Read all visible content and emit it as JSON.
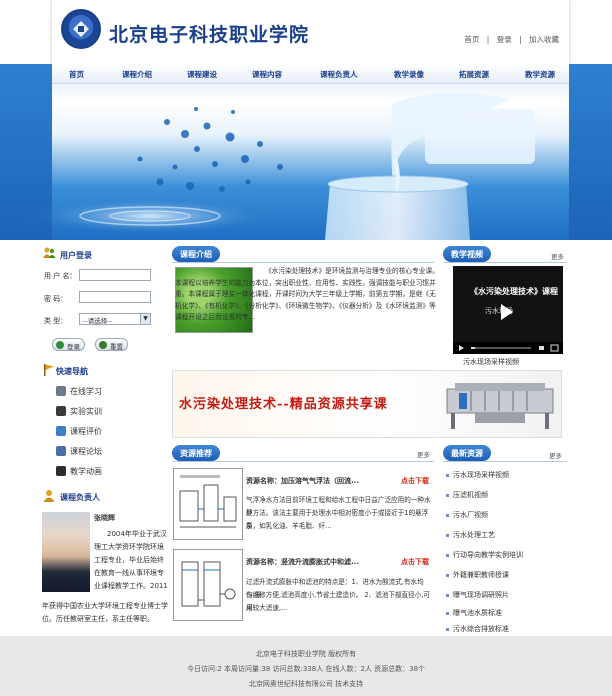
{
  "header": {
    "title": "北京电子科技职业学院",
    "toplinks": [
      "首页",
      "登录",
      "加入收藏"
    ]
  },
  "nav": [
    "首页",
    "课程介绍",
    "课程建设",
    "课程内容",
    "课程负责人",
    "教学录像",
    "拓展资源",
    "教学资源"
  ],
  "login": {
    "heading": "用户登录",
    "username_label": "用 户 名：",
    "password_label": "密    码：",
    "type_label": "类    型：",
    "type_selected": "--请选择--",
    "login_button": "登录",
    "reset_button": "重置"
  },
  "quick_nav": {
    "heading": "快速导航",
    "items": [
      "在线学习",
      "实验实训",
      "课程评价",
      "课程论坛",
      "教学动画"
    ]
  },
  "owner": {
    "heading": "课程负责人",
    "name": "张晓辉",
    "bio_lines": [
      "2004年毕业于武汉",
      "理工大学资环学院环境",
      "工程专业，毕业后始终",
      "在教育一线从事环境专",
      "业课程教学工作。2011"
    ],
    "bio_tail": [
      "年获得中国农业大学环境工程专业博士学",
      "位。历任教研室主任，系主任等职。"
    ]
  },
  "intro": {
    "heading": "课程介绍",
    "text": "《水污染处理技术》是环境监测与治理专业的核心专业课。本课程以培养学生的能力为本位，突出职业性、应用性、实践性，强调技能与职业习惯并重。本课程属于理实一体化课程，开课时间为大学三年级上学期，前第五学期，是继《无机化学》、《有机化学》、《分析化学》、《环境微生物学》、《仪器分析》及《水环境监测》等课程开设之后而设置的专..."
  },
  "video": {
    "heading": "教学视频",
    "more": "更多",
    "title": "《水污染处理技术》课程",
    "sub": "污水现场",
    "caption": "污水现场采样视频"
  },
  "banner": {
    "text": "水污染处理技术--精品资源共享课"
  },
  "resources": {
    "heading": "资源推荐",
    "more": "更多",
    "items": [
      {
        "title": "资源名称：加压溶气气浮法（回流...",
        "download": "点击下载",
        "desc_lines": [
          "气浮净水方法目前环境工程和给水工程中日益广泛应用的一种水处",
          "理方法。该法主要用于处理水中相对密度小于或接近于1的悬浮杂",
          "质，如乳化油、羊毛脂、纤..."
        ]
      },
      {
        "title": "资源名称：竖流升流膨胀式中和滤...",
        "download": "点击下载",
        "desc_lines": [
          "过滤升流式膨胀中和滤池的特点是：1、进水为酸流式,有水均匀,操",
          "作维修方便,滤池高度小,节省土建造价。  2、滤池下部直径小,可采",
          "用较大滤速,..."
        ]
      }
    ]
  },
  "latest": {
    "heading": "最新资源",
    "more": "更多",
    "items": [
      "污水现场采样视频",
      "压滤机视频",
      "污水厂视频",
      "污水处理工艺",
      "行动导向教学实例培训",
      "外籍兼职教师授课",
      "曝气现场调研照片",
      "曝气池水质标准",
      "污水综合排放标准"
    ]
  },
  "footer": {
    "line1": "北京电子科技职业学院    版权所有",
    "line2": "今日访问:2  本周访问量:38  访问总数:338人  在线人数：2人  资源总数：38个",
    "line3": "北京网奥世纪科技有限公司    技术支持"
  }
}
